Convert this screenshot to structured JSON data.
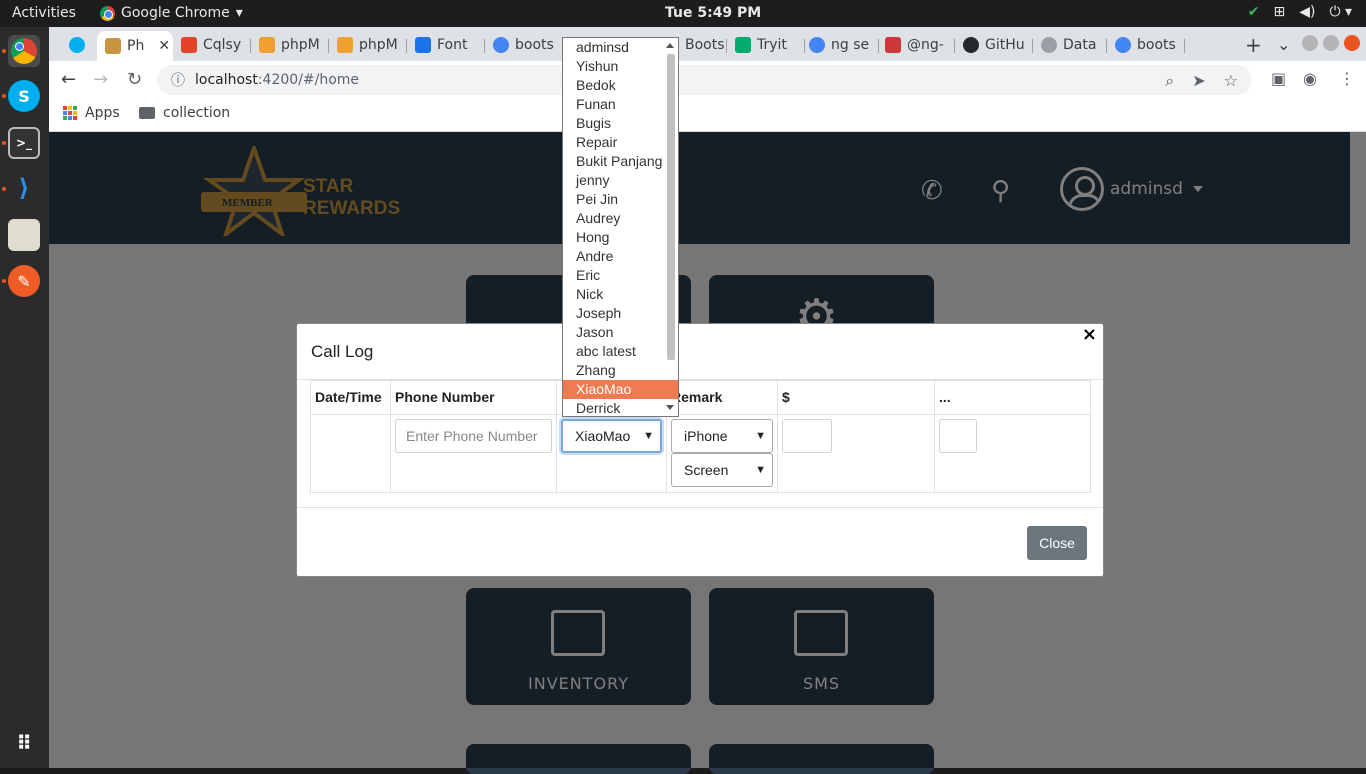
{
  "os": {
    "activities": "Activities",
    "app_name": "Google Chrome",
    "clock": "Tue  5:49 PM"
  },
  "browser": {
    "tabs": [
      {
        "label": "Ph",
        "active": true
      },
      {
        "label": "Cqlsy"
      },
      {
        "label": "phpM"
      },
      {
        "label": "phpM"
      },
      {
        "label": "Font"
      },
      {
        "label": "boots"
      },
      {
        "label": "Boots"
      },
      {
        "label": "Tryit"
      },
      {
        "label": "ng se"
      },
      {
        "label": "@ng-"
      },
      {
        "label": "GitHu"
      },
      {
        "label": "Data"
      },
      {
        "label": "boots"
      }
    ],
    "url_host": "localhost",
    "url_path": ":4200/#/home",
    "bookmarks": {
      "apps": "Apps",
      "collection": "collection"
    }
  },
  "app": {
    "logo_badge": "MEMBER",
    "logo_line1": "STAR",
    "logo_line2": "REWARDS",
    "username": "adminsd",
    "tiles": [
      {
        "label": "INVENTORY"
      },
      {
        "label": "SMS"
      }
    ]
  },
  "modal": {
    "title": "Call Log",
    "close_x": "×",
    "columns": [
      "Date/Time",
      "Phone Number",
      "",
      "Remark",
      "$",
      "..."
    ],
    "phone_placeholder": "Enter Phone Number",
    "staff_selected": "XiaoMao",
    "remark_device": "iPhone",
    "remark_issue": "Screen",
    "close_button": "Close"
  },
  "dropdown": {
    "options": [
      "adminsd",
      "Yishun",
      "Bedok",
      "Funan",
      "Bugis",
      "Repair",
      "Bukit Panjang",
      "jenny",
      "Pei Jin",
      "Audrey",
      "Hong",
      "Andre",
      "Eric",
      "Nick",
      "Joseph",
      "Jason",
      "abc latest",
      "Zhang",
      "XiaoMao",
      "Derrick"
    ],
    "highlighted": "XiaoMao"
  },
  "colors": {
    "header_bg": "#2a3a4b",
    "accent_gold": "#c8963e",
    "highlight": "#f07b52",
    "close_btn": "#6c757d"
  }
}
